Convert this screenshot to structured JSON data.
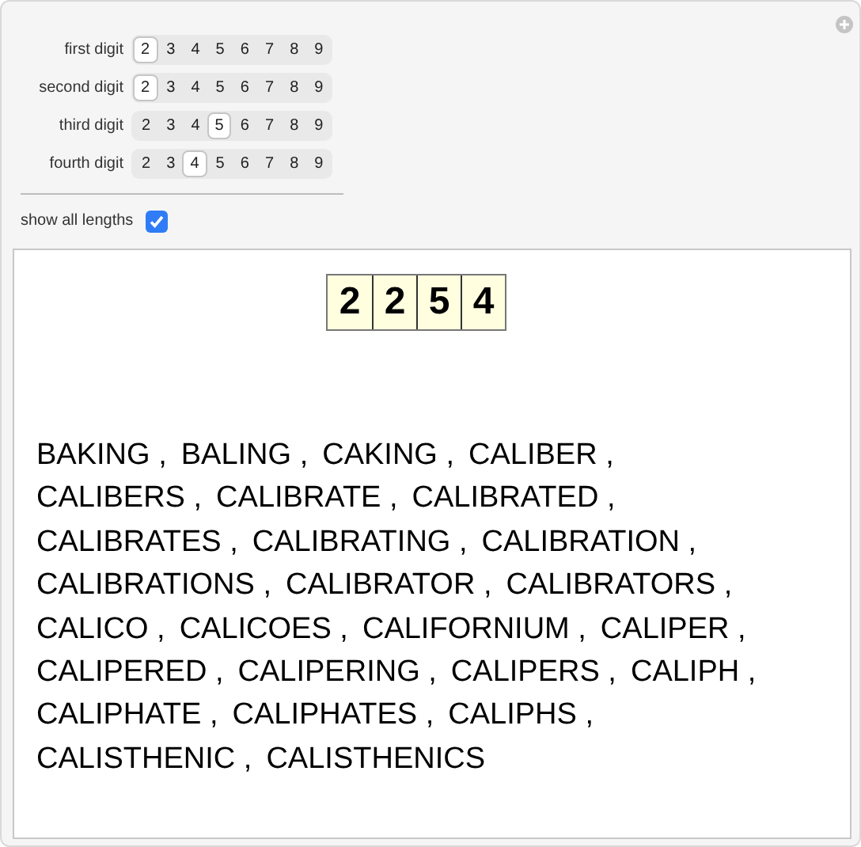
{
  "controls": [
    {
      "label": "first digit",
      "options": [
        {
          "label": "2",
          "selected": true
        },
        {
          "label": "3",
          "selected": false
        },
        {
          "label": "4",
          "selected": false
        },
        {
          "label": "5",
          "selected": false
        },
        {
          "label": "6",
          "selected": false
        },
        {
          "label": "7",
          "selected": false
        },
        {
          "label": "8",
          "selected": false
        },
        {
          "label": "9",
          "selected": false
        }
      ]
    },
    {
      "label": "second digit",
      "options": [
        {
          "label": "2",
          "selected": true
        },
        {
          "label": "3",
          "selected": false
        },
        {
          "label": "4",
          "selected": false
        },
        {
          "label": "5",
          "selected": false
        },
        {
          "label": "6",
          "selected": false
        },
        {
          "label": "7",
          "selected": false
        },
        {
          "label": "8",
          "selected": false
        },
        {
          "label": "9",
          "selected": false
        }
      ]
    },
    {
      "label": "third digit",
      "options": [
        {
          "label": "2",
          "selected": false
        },
        {
          "label": "3",
          "selected": false
        },
        {
          "label": "4",
          "selected": false
        },
        {
          "label": "5",
          "selected": true
        },
        {
          "label": "6",
          "selected": false
        },
        {
          "label": "7",
          "selected": false
        },
        {
          "label": "8",
          "selected": false
        },
        {
          "label": "9",
          "selected": false
        }
      ]
    },
    {
      "label": "fourth digit",
      "options": [
        {
          "label": "2",
          "selected": false
        },
        {
          "label": "3",
          "selected": false
        },
        {
          "label": "4",
          "selected": true
        },
        {
          "label": "5",
          "selected": false
        },
        {
          "label": "6",
          "selected": false
        },
        {
          "label": "7",
          "selected": false
        },
        {
          "label": "8",
          "selected": false
        },
        {
          "label": "9",
          "selected": false
        }
      ]
    }
  ],
  "show_all_lengths": {
    "label": "show all lengths",
    "checked": true
  },
  "digits": [
    "2",
    "2",
    "5",
    "4"
  ],
  "words": [
    "BAKING ,",
    "BALING ,",
    "CAKING ,",
    "CALIBER ,",
    "CALIBERS ,",
    "CALIBRATE ,",
    "CALIBRATED ,",
    "CALIBRATES ,",
    "CALIBRATING ,",
    "CALIBRATION ,",
    "CALIBRATIONS ,",
    "CALIBRATOR ,",
    "CALIBRATORS ,",
    "CALICO ,",
    "CALICOES ,",
    "CALIFORNIUM ,",
    "CALIPER ,",
    "CALIPERED ,",
    "CALIPERING ,",
    "CALIPERS ,",
    "CALIPH ,",
    "CALIPHATE ,",
    "CALIPHATES ,",
    "CALIPHS ,",
    "CALISTHENIC ,",
    "CALISTHENICS"
  ]
}
